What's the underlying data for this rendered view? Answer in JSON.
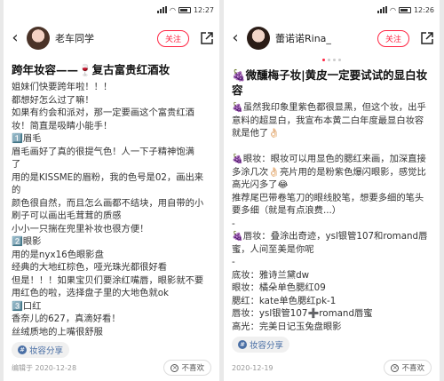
{
  "left": {
    "status": {
      "time": "12:27"
    },
    "author": "老车同学",
    "follow_label": "关注",
    "title": "跨年妆容——🍷复古富贵红酒妆",
    "lines": [
      "姐妹们快要跨年啦！！！",
      "都想好怎么过了嘛！",
      "如果有约会和派对，那一定要画这个富贵红酒",
      "妆！简直是吸睛小能手！",
      "1️⃣眉毛",
      "眉毛画好了真的很提气色！人一下子精神饱满",
      "了",
      "用的是KISSME的眉粉，我的色号是02，画出来的",
      "颜色很自然，而且怎么画都不结块，用自带的小",
      "刷子可以画出毛茸茸的质感",
      "小小一只揣在兜里补妆也很方便！",
      "2️⃣眼影",
      "用的是nyx16色眼影盘",
      "经典的大地红棕色，哑光珠光都很好看",
      "但是！！！如果宝贝们要涂红嘴唇，眼影就不要",
      "用红色的啦，选择盘子里的大地色就ok",
      "3️⃣口红",
      "香奈儿的627，真滴好看！",
      "丝绒质地的上嘴很舒服"
    ],
    "tag": "妆容分享",
    "date": "编辑于 2020-12-28",
    "dislike": "不喜欢"
  },
  "right": {
    "status": {
      "time": "12:26"
    },
    "author": "蕾诺诺Rina_",
    "follow_label": "关注",
    "title": "🍇微醺梅子妆|黄皮一定要试试的显白妆容",
    "lines": [
      "🍇虽然我印象里紫色都很显黑，但这个妆，出乎",
      "意料的超显白，我宣布本黄二白年度最显白妆容",
      "就是他了👌🏻",
      "",
      "🍇眼妆：眼妆可以用显色的腮红来画，加深直接",
      "多涂几次👌🏻亮片用的是粉紫色爆闪眼影，感觉比",
      "高光闪多了😂",
      "推荐尾巴带卷笔刀的眼线胶笔，想要多细的笔头",
      "要多细（就是有点浪费...）",
      "-",
      "🍇唇妆：叠涂出奇迹，ysl银管107和romand唇",
      "蜜，人间至美是你呢",
      "-",
      "底妆：雅诗兰黛dw",
      "眼妆：橘朵单色腮红09",
      "腮红：kate单色腮红pk-1",
      "唇妆：ysl银管107➕romand唇蜜",
      "高光：完美日记玉兔盘眼影"
    ],
    "tag": "妆容分享",
    "date": "2020-12-19",
    "dislike": "不喜欢"
  }
}
